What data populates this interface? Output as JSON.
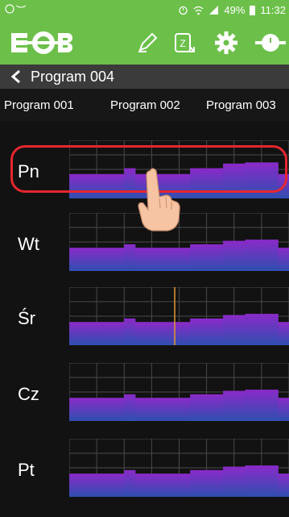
{
  "status_bar": {
    "battery": "49%",
    "time": "11:32",
    "icons": [
      "alarm-icon",
      "wifi-icon",
      "signal-icon",
      "battery-icon"
    ]
  },
  "toolbar": {
    "icons": [
      "edit-icon",
      "copy-z-icon",
      "settings-gear-icon",
      "temperature-probe-icon"
    ]
  },
  "header": {
    "title": "Program 004"
  },
  "tabs": [
    "Program 001",
    "Program 002",
    "Program 003"
  ],
  "days": [
    {
      "label": "Pn",
      "levels": [
        0.42,
        0.42,
        0.42,
        0.42,
        0.42,
        0.52,
        0.42,
        0.42,
        0.42,
        0.42,
        0.42,
        0.52,
        0.52,
        0.52,
        0.6,
        0.6,
        0.62,
        0.62,
        0.62,
        0.42
      ]
    },
    {
      "label": "Wt",
      "levels": [
        0.4,
        0.4,
        0.4,
        0.4,
        0.4,
        0.46,
        0.4,
        0.4,
        0.4,
        0.4,
        0.4,
        0.46,
        0.46,
        0.46,
        0.52,
        0.52,
        0.54,
        0.54,
        0.54,
        0.4
      ]
    },
    {
      "label": "Śr",
      "levels": [
        0.4,
        0.4,
        0.4,
        0.4,
        0.4,
        0.46,
        0.4,
        0.4,
        0.4,
        0.4,
        0.4,
        0.46,
        0.46,
        0.46,
        0.52,
        0.52,
        0.54,
        0.54,
        0.54,
        0.4
      ]
    },
    {
      "label": "Cz",
      "levels": [
        0.4,
        0.4,
        0.4,
        0.4,
        0.4,
        0.46,
        0.4,
        0.4,
        0.4,
        0.4,
        0.4,
        0.46,
        0.46,
        0.46,
        0.52,
        0.52,
        0.54,
        0.54,
        0.54,
        0.4
      ]
    },
    {
      "label": "Pt",
      "levels": [
        0.4,
        0.4,
        0.4,
        0.4,
        0.4,
        0.46,
        0.4,
        0.4,
        0.4,
        0.4,
        0.4,
        0.46,
        0.46,
        0.46,
        0.52,
        0.52,
        0.54,
        0.54,
        0.54,
        0.4
      ]
    }
  ],
  "colors": {
    "accent_green": "#6cc04a",
    "highlight_red": "#e5262f",
    "chart_top": "#8a2ac8",
    "chart_bottom": "#2e4fb0",
    "marker_orange": "#e39a2e"
  }
}
